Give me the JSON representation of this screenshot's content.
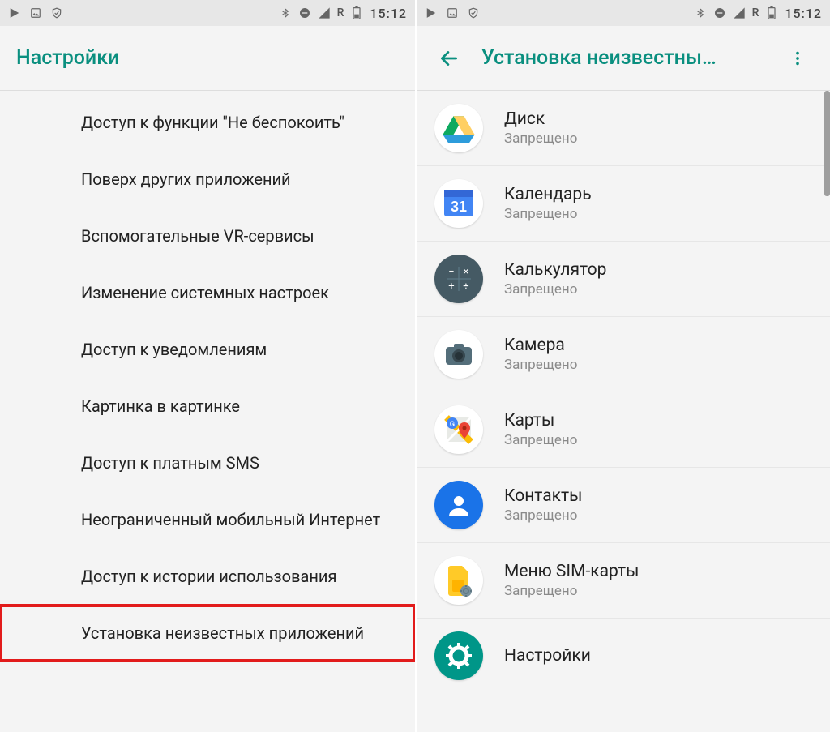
{
  "status": {
    "time": "15:12",
    "roaming": "R"
  },
  "left": {
    "title": "Настройки",
    "items": [
      "Доступ к функции \"Не беспокоить\"",
      "Поверх других приложений",
      "Вспомогательные VR-сервисы",
      "Изменение системных настроек",
      "Доступ к уведомлениям",
      "Картинка в картинке",
      "Доступ к платным SMS",
      "Неограниченный мобильный Интернет",
      "Доступ к истории использования",
      "Установка неизвестных приложений"
    ]
  },
  "right": {
    "title": "Установка неизвестны…",
    "denied": "Запрещено",
    "apps": [
      {
        "name": "Диск"
      },
      {
        "name": "Календарь"
      },
      {
        "name": "Калькулятор"
      },
      {
        "name": "Камера"
      },
      {
        "name": "Карты"
      },
      {
        "name": "Контакты"
      },
      {
        "name": "Меню SIM-карты"
      },
      {
        "name": "Настройки"
      }
    ]
  }
}
